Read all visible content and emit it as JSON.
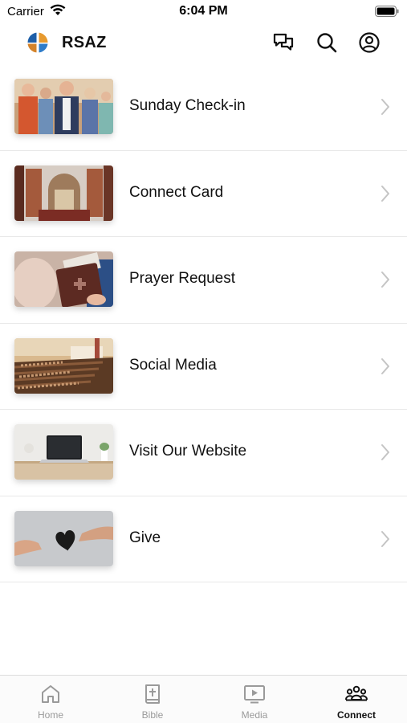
{
  "status_bar": {
    "carrier": "Carrier",
    "time": "6:04 PM"
  },
  "header": {
    "title": "RSAZ",
    "icons": [
      "chat-icon",
      "search-icon",
      "profile-icon"
    ],
    "logo_colors": [
      "#1e5fa8",
      "#e79a2e",
      "#2e7cc9",
      "#d4832a"
    ]
  },
  "items": [
    {
      "label": "Sunday Check-in",
      "thumb": "people-greeting-image"
    },
    {
      "label": "Connect Card",
      "thumb": "church-entrance-image"
    },
    {
      "label": "Prayer Request",
      "thumb": "bible-in-hands-image"
    },
    {
      "label": "Social Media",
      "thumb": "church-congregation-image"
    },
    {
      "label": "Visit Our Website",
      "thumb": "laptop-desk-image"
    },
    {
      "label": "Give",
      "thumb": "give-heart-image"
    }
  ],
  "tabs": [
    {
      "label": "Home",
      "icon": "home-icon",
      "active": false
    },
    {
      "label": "Bible",
      "icon": "bible-icon",
      "active": false
    },
    {
      "label": "Media",
      "icon": "media-icon",
      "active": false
    },
    {
      "label": "Connect",
      "icon": "people-icon",
      "active": true
    }
  ],
  "colors": {
    "active_tab": "#111111",
    "inactive_tab": "#9a9a9a",
    "divider": "#e8e8e8"
  }
}
